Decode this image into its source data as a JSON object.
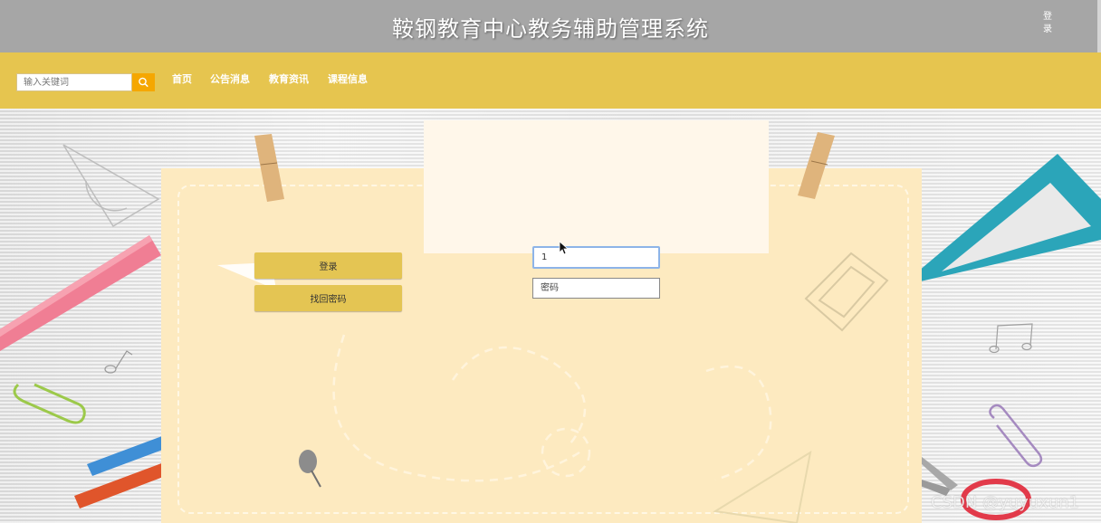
{
  "header": {
    "title": "鞍钢教育中心教务辅助管理系统",
    "login_link": "登录"
  },
  "navbar": {
    "search": {
      "placeholder": "输入关键词",
      "button_icon": "search-icon"
    },
    "items": [
      {
        "label": "首页"
      },
      {
        "label": "公告消息"
      },
      {
        "label": "教育资讯"
      },
      {
        "label": "课程信息"
      }
    ]
  },
  "login": {
    "login_button": "登录",
    "recover_button": "找回密码",
    "username_value": "1",
    "password_placeholder": "密码"
  },
  "watermark": "CSDN @yuyuxun1",
  "colors": {
    "header_bg": "#a6a6a6",
    "navbar_bg": "#e6c54f",
    "search_button": "#f5a700",
    "paper": "#fdeac0",
    "button": "#e4c553"
  }
}
